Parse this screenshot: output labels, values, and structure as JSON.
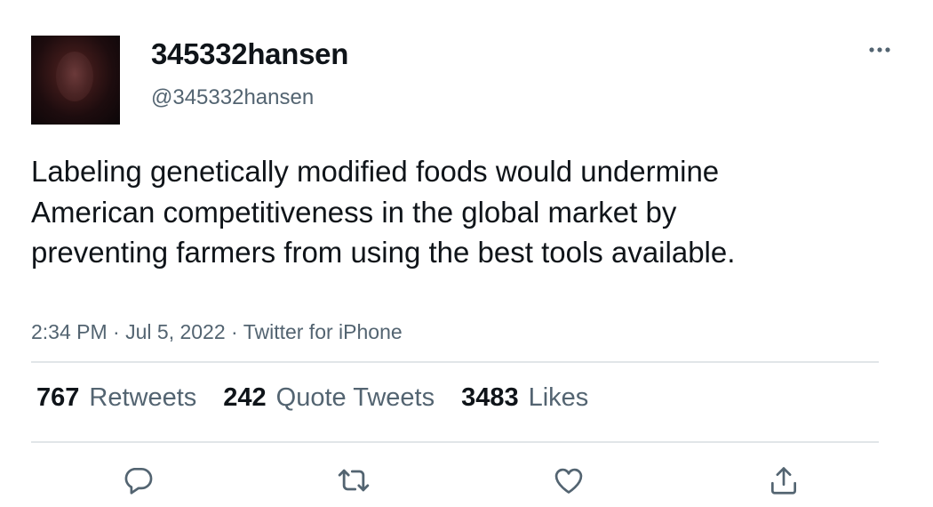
{
  "user": {
    "display_name": "345332hansen",
    "handle": "@345332hansen"
  },
  "tweet": {
    "text": "Labeling genetically modified foods would undermine American competitiveness in the global market by preventing farmers from using the best tools available.",
    "time": "2:34 PM",
    "date": "Jul 5, 2022",
    "source": "Twitter for iPhone",
    "separator": "·"
  },
  "stats": {
    "retweets": {
      "count": "767",
      "label": "Retweets"
    },
    "quotes": {
      "count": "242",
      "label": "Quote Tweets"
    },
    "likes": {
      "count": "3483",
      "label": "Likes"
    }
  },
  "icons": {
    "more": "more-horizontal-icon",
    "reply": "reply-icon",
    "retweet": "retweet-icon",
    "like": "heart-icon",
    "share": "share-icon"
  },
  "colors": {
    "text": "#0f1419",
    "secondary": "#536471",
    "divider": "#e1e5e8"
  }
}
